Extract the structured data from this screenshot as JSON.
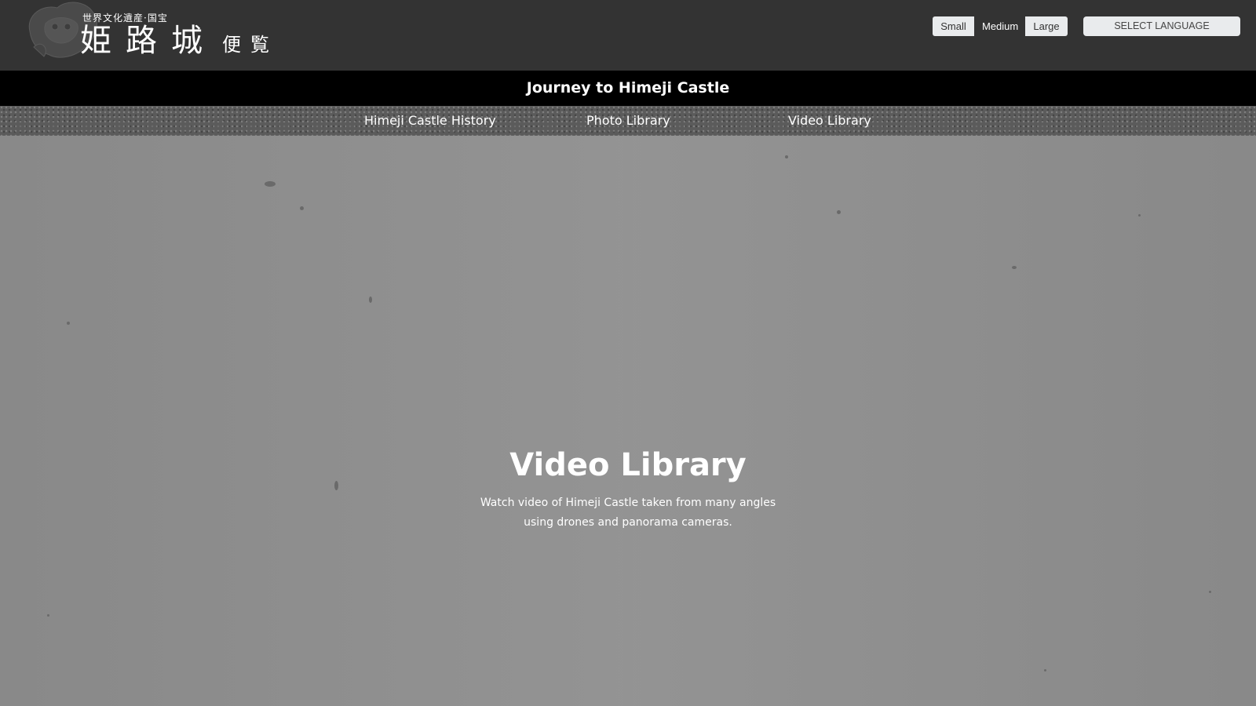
{
  "header": {
    "logo": {
      "subtitle": "世界文化遺産·国宝",
      "name_main": "姫路城",
      "name_small": "便覧"
    },
    "font_size": {
      "small": "Small",
      "medium": "Medium",
      "large": "Large"
    },
    "language_select": "SELECT LANGUAGE"
  },
  "site_title": "Journey to Himeji Castle",
  "nav": {
    "items": [
      {
        "label": "Himeji Castle History"
      },
      {
        "label": "Photo Library"
      },
      {
        "label": "Video Library"
      }
    ]
  },
  "hero": {
    "title": "Video Library",
    "description_line1": "Watch video of Himeji Castle taken from many angles",
    "description_line2": "using drones and panorama cameras."
  },
  "colors": {
    "header_bg": "#333333",
    "title_bar_bg": "#000000",
    "hero_bg": "#909090",
    "button_light": "#e9ebed"
  }
}
